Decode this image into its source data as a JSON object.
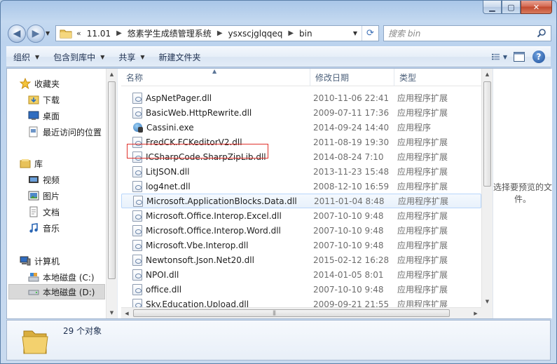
{
  "window": {
    "caption": {
      "minimize": "▁",
      "maximize": "▢",
      "close": "✕"
    }
  },
  "nav": {
    "back_icon": "back-arrow-icon",
    "forward_icon": "forward-arrow-icon",
    "breadcrumbs": [
      "11.01",
      "悠素学生成绩管理系统",
      "ysxscjglqqeq",
      "bin"
    ],
    "overflow": "«",
    "search_placeholder": "搜索 bin"
  },
  "toolbar": {
    "organize": "组织",
    "include_in_library": "包含到库中",
    "share": "共享",
    "new_folder": "新建文件夹"
  },
  "sidebar": {
    "favorites": {
      "label": "收藏夹",
      "items": [
        {
          "label": "下载",
          "icon": "download-folder-icon"
        },
        {
          "label": "桌面",
          "icon": "desktop-icon"
        },
        {
          "label": "最近访问的位置",
          "icon": "recent-places-icon"
        }
      ]
    },
    "libraries": {
      "label": "库",
      "items": [
        {
          "label": "视频",
          "icon": "video-library-icon"
        },
        {
          "label": "图片",
          "icon": "pictures-library-icon"
        },
        {
          "label": "文档",
          "icon": "documents-library-icon"
        },
        {
          "label": "音乐",
          "icon": "music-library-icon"
        }
      ]
    },
    "computer": {
      "label": "计算机",
      "items": [
        {
          "label": "本地磁盘 (C:)",
          "icon": "drive-c-icon"
        },
        {
          "label": "本地磁盘 (D:)",
          "icon": "drive-d-icon",
          "selected": true
        }
      ]
    }
  },
  "columns": {
    "name": "名称",
    "date": "修改日期",
    "type": "类型"
  },
  "files": [
    {
      "name": "AspNetPager.dll",
      "date": "2010-11-06 22:41",
      "type": "应用程序扩展",
      "kind": "dll"
    },
    {
      "name": "BasicWeb.HttpRewrite.dll",
      "date": "2009-07-11 17:36",
      "type": "应用程序扩展",
      "kind": "dll"
    },
    {
      "name": "Cassini.exe",
      "date": "2014-09-24 14:40",
      "type": "应用程序",
      "kind": "exe"
    },
    {
      "name": "FredCK.FCKeditorV2.dll",
      "date": "2011-08-19 19:30",
      "type": "应用程序扩展",
      "kind": "dll"
    },
    {
      "name": "ICSharpCode.SharpZipLib.dll",
      "date": "2014-08-24 7:10",
      "type": "应用程序扩展",
      "kind": "dll"
    },
    {
      "name": "LitJSON.dll",
      "date": "2013-11-23 15:48",
      "type": "应用程序扩展",
      "kind": "dll"
    },
    {
      "name": "log4net.dll",
      "date": "2008-12-10 16:59",
      "type": "应用程序扩展",
      "kind": "dll"
    },
    {
      "name": "Microsoft.ApplicationBlocks.Data.dll",
      "date": "2011-01-04 8:48",
      "type": "应用程序扩展",
      "kind": "dll"
    },
    {
      "name": "Microsoft.Office.Interop.Excel.dll",
      "date": "2007-10-10 9:48",
      "type": "应用程序扩展",
      "kind": "dll"
    },
    {
      "name": "Microsoft.Office.Interop.Word.dll",
      "date": "2007-10-10 9:48",
      "type": "应用程序扩展",
      "kind": "dll"
    },
    {
      "name": "Microsoft.Vbe.Interop.dll",
      "date": "2007-10-10 9:48",
      "type": "应用程序扩展",
      "kind": "dll"
    },
    {
      "name": "Newtonsoft.Json.Net20.dll",
      "date": "2015-02-12 16:28",
      "type": "应用程序扩展",
      "kind": "dll"
    },
    {
      "name": "NPOI.dll",
      "date": "2014-01-05 8:01",
      "type": "应用程序扩展",
      "kind": "dll"
    },
    {
      "name": "office.dll",
      "date": "2007-10-10 9:48",
      "type": "应用程序扩展",
      "kind": "dll"
    },
    {
      "name": "Sky.Education.Upload.dll",
      "date": "2009-09-21 21:55",
      "type": "应用程序扩展",
      "kind": "dll"
    }
  ],
  "preview": {
    "text": "选择要预览的文件。"
  },
  "status": {
    "count_text": "29 个对象"
  },
  "colors": {
    "highlight_border": "#e0312b",
    "selection_bg": "#d9d9d9"
  }
}
